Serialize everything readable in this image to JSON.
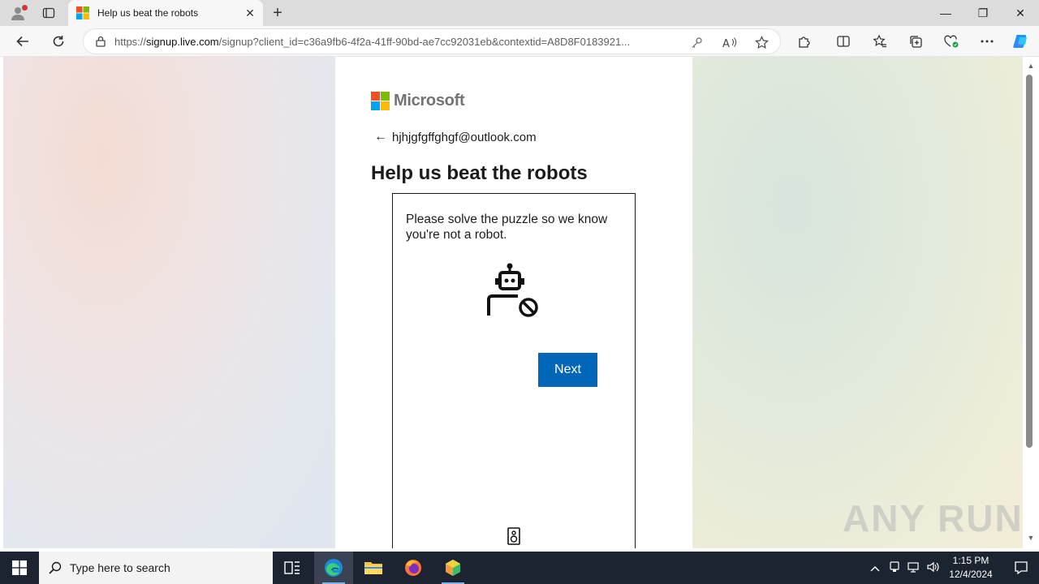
{
  "browser": {
    "tab": {
      "title": "Help us beat the robots",
      "close": "✕"
    },
    "new_tab": "+",
    "window": {
      "minimize": "—",
      "restore": "❐",
      "close": "✕"
    },
    "address": {
      "url_prefix": "https://",
      "url_host": "signup.live.com",
      "url_rest": "/signup?client_id=c36a9fb6-4f2a-41ff-90bd-ae7cc92031eb&contextid=A8D8F0183921..."
    }
  },
  "page": {
    "logo_text": "Microsoft",
    "logo_colors": [
      "#f25022",
      "#7fba00",
      "#00a4ef",
      "#ffb900"
    ],
    "back_arrow": "←",
    "email": "hjhjgfgffghgf@outlook.com",
    "heading": "Help us beat the robots",
    "puzzle": {
      "prompt": "Please solve the puzzle so we know you're not a robot.",
      "next_label": "Next"
    },
    "accent_color": "#0067b8"
  },
  "watermark": {
    "text": "ANY RUN"
  },
  "taskbar": {
    "search_placeholder": "Type here to search",
    "time": "1:15 PM",
    "date": "12/4/2024"
  }
}
